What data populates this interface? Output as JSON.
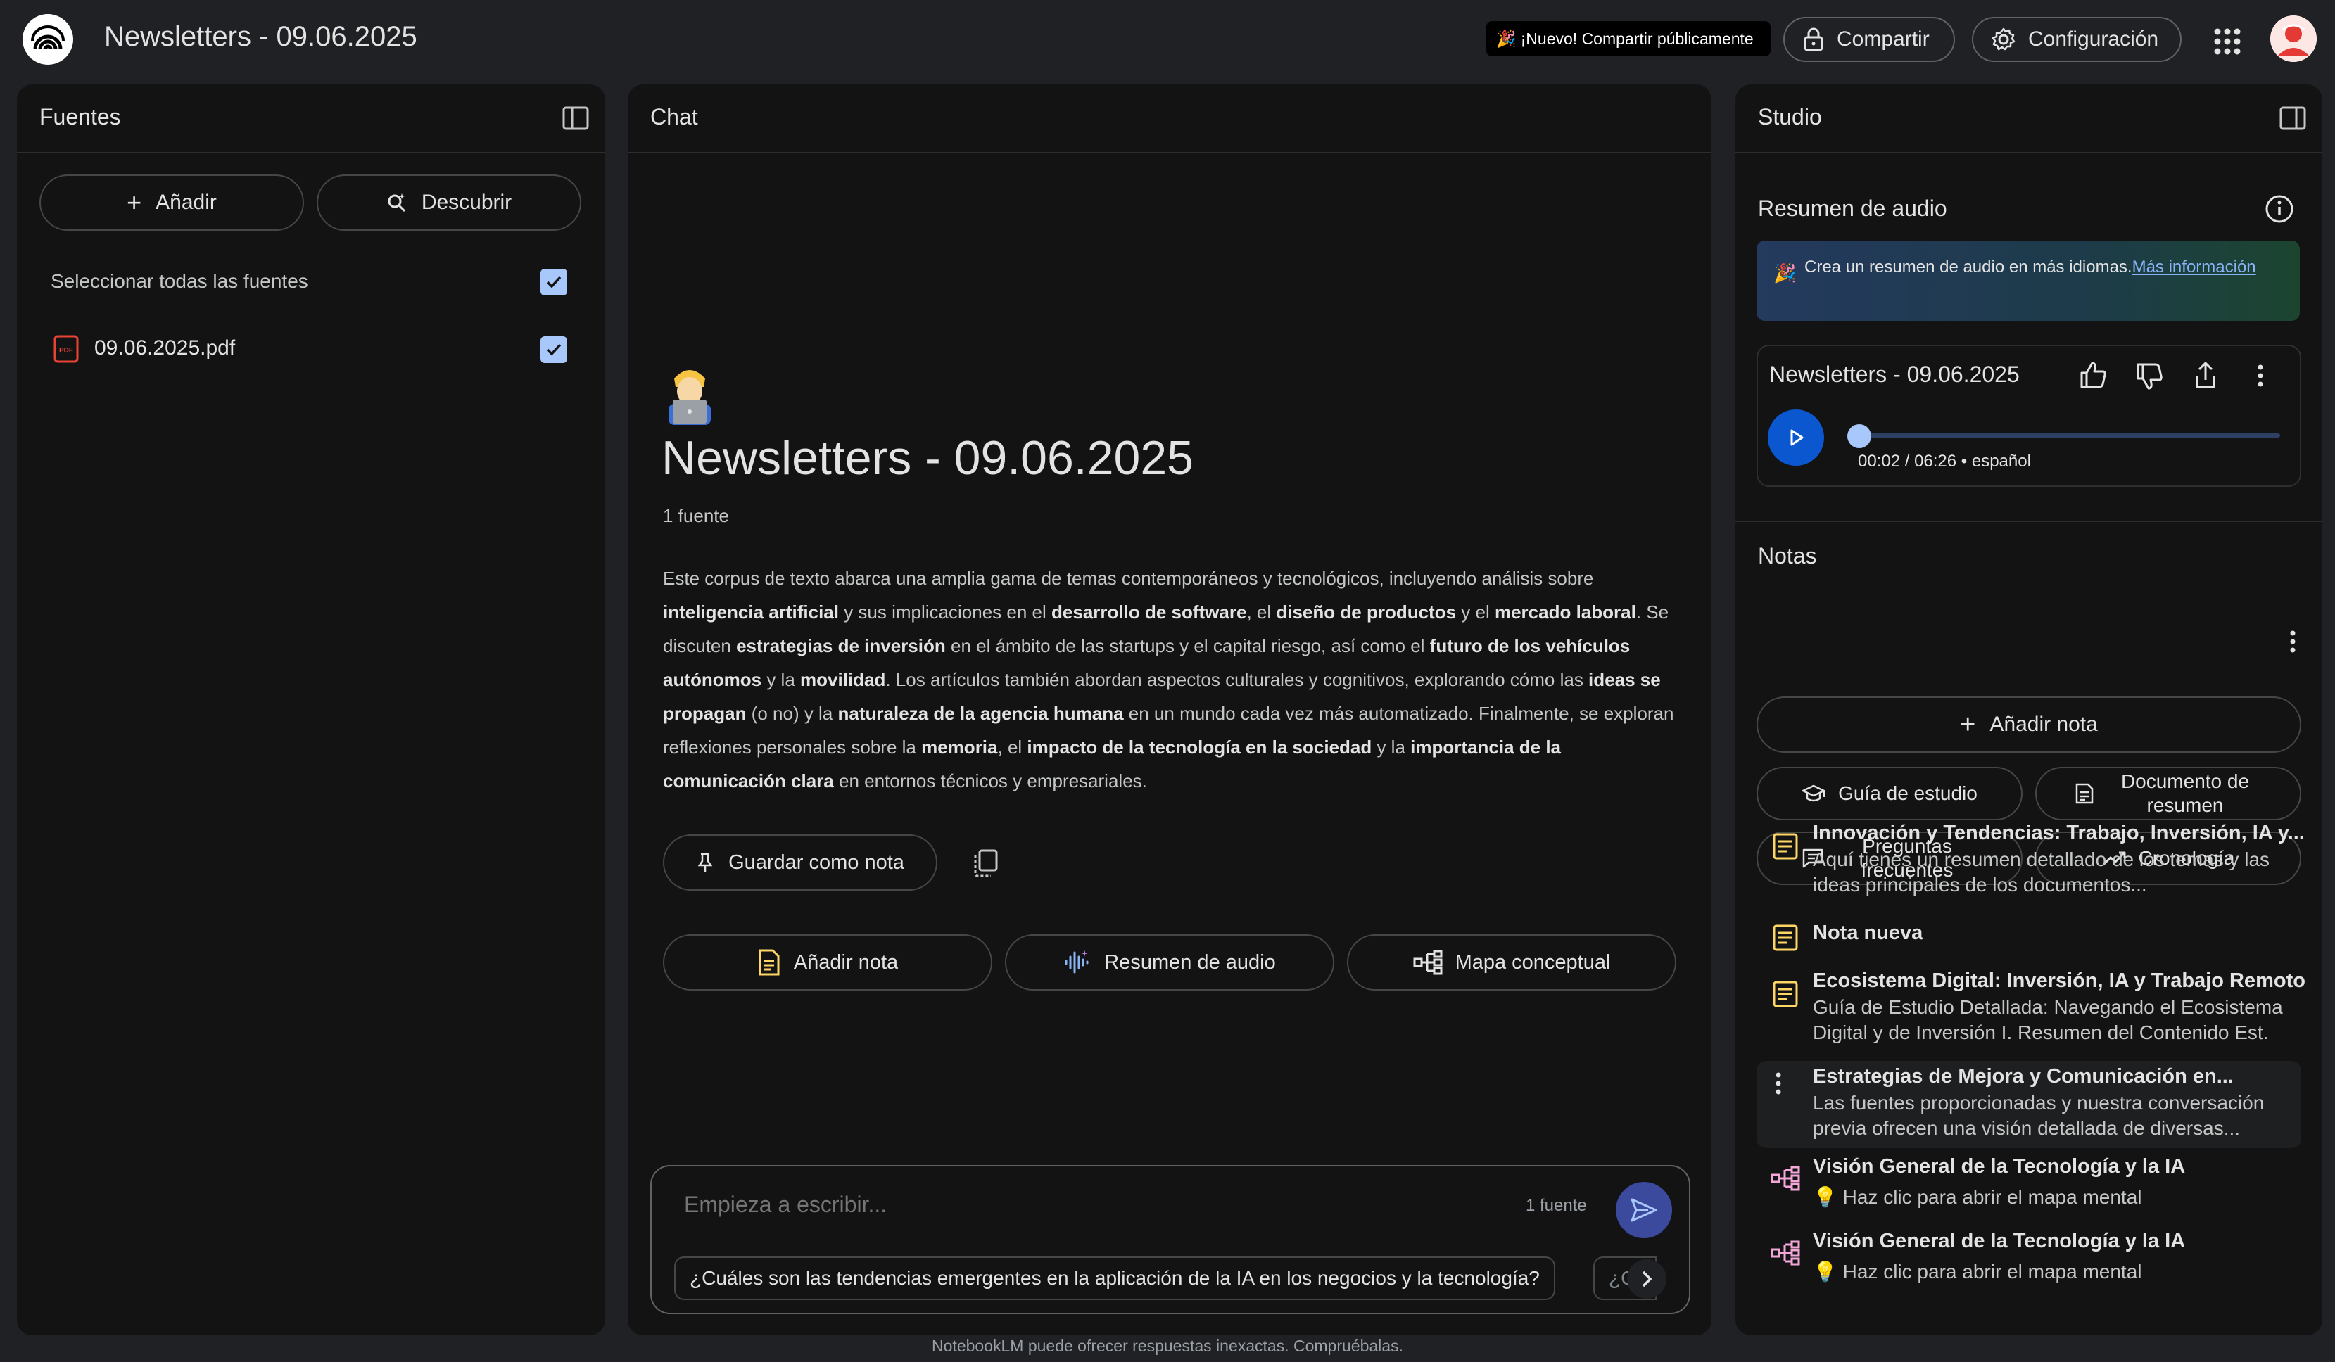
{
  "header": {
    "title": "Newsletters - 09.06.2025",
    "new_badge": "¡Nuevo! Compartir públicamente",
    "share_label": "Compartir",
    "config_label": "Configuración"
  },
  "sources": {
    "panel_title": "Fuentes",
    "add_label": "Añadir",
    "discover_label": "Descubrir",
    "select_all_label": "Seleccionar todas las fuentes",
    "select_all_checked": true,
    "items": [
      {
        "name": "09.06.2025.pdf",
        "checked": true
      }
    ]
  },
  "chat": {
    "panel_title": "Chat",
    "title": "Newsletters - 09.06.2025",
    "source_count": "1 fuente",
    "summary_segments": [
      {
        "t": "Este corpus de texto abarca una amplia gama de temas contemporáneos y tecnológicos, incluyendo análisis sobre ",
        "b": false
      },
      {
        "t": "inteligencia artificial",
        "b": true
      },
      {
        "t": " y sus implicaciones en el ",
        "b": false
      },
      {
        "t": "desarrollo de software",
        "b": true
      },
      {
        "t": ", el ",
        "b": false
      },
      {
        "t": "diseño de productos",
        "b": true
      },
      {
        "t": " y el ",
        "b": false
      },
      {
        "t": "mercado laboral",
        "b": true
      },
      {
        "t": ". Se discuten ",
        "b": false
      },
      {
        "t": "estrategias de inversión",
        "b": true
      },
      {
        "t": " en el ámbito de las startups y el capital riesgo, así como el ",
        "b": false
      },
      {
        "t": "futuro de los vehículos autónomos",
        "b": true
      },
      {
        "t": " y la ",
        "b": false
      },
      {
        "t": "movilidad",
        "b": true
      },
      {
        "t": ". Los artículos también abordan aspectos culturales y cognitivos, explorando cómo las ",
        "b": false
      },
      {
        "t": "ideas se propagan",
        "b": true
      },
      {
        "t": " (o no) y la ",
        "b": false
      },
      {
        "t": "naturaleza de la agencia humana",
        "b": true
      },
      {
        "t": " en un mundo cada vez más automatizado. Finalmente, se exploran reflexiones personales sobre la ",
        "b": false
      },
      {
        "t": "memoria",
        "b": true
      },
      {
        "t": ", el ",
        "b": false
      },
      {
        "t": "impacto de la tecnología en la sociedad",
        "b": true
      },
      {
        "t": " y la ",
        "b": false
      },
      {
        "t": "importancia de la comunicación clara",
        "b": true
      },
      {
        "t": " en entornos técnicos y empresariales.",
        "b": false
      }
    ],
    "save_note_label": "Guardar como nota",
    "actions": {
      "add_note": "Añadir nota",
      "audio_summary": "Resumen de audio",
      "mind_map": "Mapa conceptual"
    },
    "composer": {
      "placeholder": "Empieza a escribir...",
      "source_count": "1 fuente",
      "suggestion": "¿Cuáles son las tendencias emergentes en la aplicación de la IA en los negocios y la tecnología?",
      "suggestion_next": "¿Cóm"
    }
  },
  "studio": {
    "panel_title": "Studio",
    "audio_section": "Resumen de audio",
    "promo_text": "Crea un resumen de audio en más idiomas.",
    "promo_link": "Más información",
    "audio": {
      "title": "Newsletters - 09.06.2025",
      "time": "00:02 / 06:26 • español",
      "progress": 0.005
    },
    "notes_section": "Notas",
    "add_note_label": "Añadir nota",
    "buttons": {
      "study_guide": "Guía de estudio",
      "summary_doc": "Documento de resumen",
      "faq": "Preguntas frecuentes",
      "timeline": "Cronología"
    },
    "notes": [
      {
        "title": "Innovación y Tendencias: Trabajo, Inversión, IA y...",
        "sub": "Aquí tienes un resumen detallado de los temas y las ideas principales de los documentos...",
        "icon": "note-icon"
      },
      {
        "title": "Nota nueva",
        "sub": "",
        "icon": "note-icon"
      },
      {
        "title": "Ecosistema Digital: Inversión, IA y Trabajo Remoto",
        "sub": "Guía de Estudio Detallada: Navegando el Ecosistema Digital y de Inversión I. Resumen del Contenido Est.",
        "icon": "note-icon"
      },
      {
        "title": "Estrategias de Mejora y Comunicación en...",
        "sub": "Las fuentes proporcionadas y nuestra conversación previa ofrecen una visión detallada de diversas...",
        "icon": "more-icon"
      },
      {
        "title": "Visión General de la Tecnología y la IA",
        "sub": "💡 Haz clic para abrir el mapa mental",
        "icon": "mind-map-icon"
      },
      {
        "title": "Visión General de la Tecnología y la IA",
        "sub": "💡 Haz clic para abrir el mapa mental",
        "icon": "mind-map-icon"
      }
    ]
  },
  "footer": "NotebookLM puede ofrecer respuestas inexactas. Compruébalas.",
  "colors": {
    "background": "#202124",
    "panel": "#131314",
    "accent_blue": "#0b57d0",
    "note_yellow": "#fdd663",
    "mindmap_pink": "#f2a7d8"
  }
}
